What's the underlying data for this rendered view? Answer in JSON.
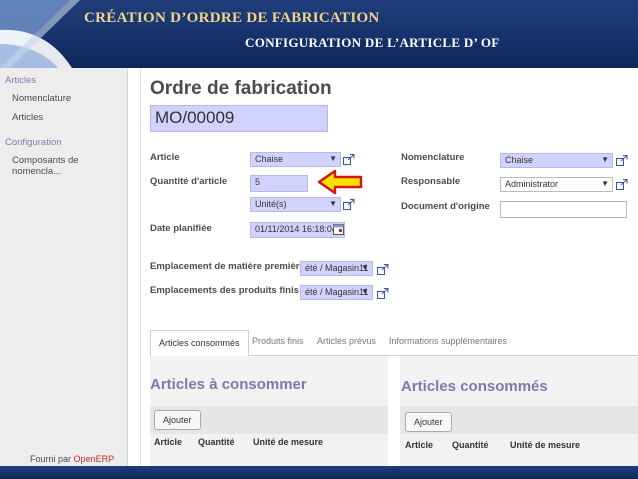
{
  "slide": {
    "title": "CRÉATION D’ORDRE DE FABRICATION",
    "subtitle": "CONFIGURATION DE L’ARTICLE D’ OF"
  },
  "sidebar": {
    "section1": "Articles",
    "items1": [
      "Nomenclature",
      "Articles"
    ],
    "section2": "Configuration",
    "items2": [
      "Composants de nomencla..."
    ],
    "powered_prefix": "Fourni par",
    "powered_brand": "OpenERP"
  },
  "form": {
    "title": "Ordre de fabrication",
    "reference": "MO/00009",
    "labels": {
      "article": "Article",
      "quantity": "Quantité d'article",
      "planned_date": "Date planifiée",
      "bom": "Nomenclature",
      "responsible": "Responsable",
      "origin": "Document d'origine",
      "raw_location": "Emplacement de matière première",
      "finished_location": "Emplacements des produits finis"
    },
    "values": {
      "article": "Chaise",
      "quantity": "5",
      "uom": "Unité(s)",
      "planned_date": "01/11/2014 16:18:04",
      "bom": "Chaise",
      "responsible": "Administrator",
      "origin": "",
      "raw_location": "été / Magasin11",
      "finished_location": "été / Magasin11"
    }
  },
  "tabs": [
    "Articles consommés",
    "Produits finis",
    "Articles prévus",
    "Informations supplémentaires"
  ],
  "left_panel": {
    "title": "Articles à consommer",
    "add_button": "Ajouter",
    "columns": [
      "Article",
      "Quantité",
      "Unité de mesure"
    ]
  },
  "right_panel": {
    "title": "Articles consommés",
    "add_button": "Ajouter",
    "columns": [
      "Article",
      "Quantité",
      "Unité de mesure"
    ]
  },
  "colors": {
    "banner": "#15306a",
    "banner_title": "#f5d38a",
    "required_field": "#d2d2ff",
    "accent": "#7c7bad",
    "arrow_fill": "#f7e000",
    "arrow_border": "#d01818"
  }
}
